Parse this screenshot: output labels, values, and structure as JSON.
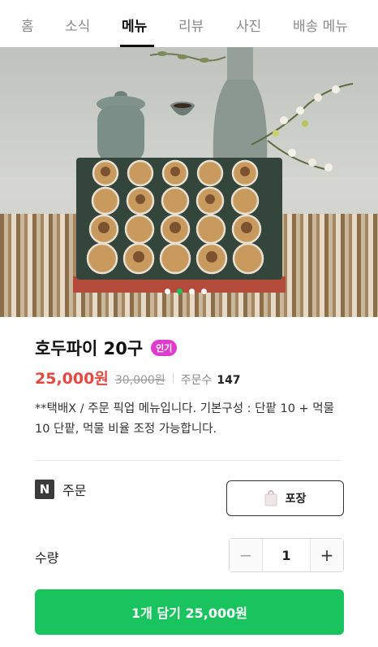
{
  "tabs": [
    {
      "label": "홈"
    },
    {
      "label": "소식"
    },
    {
      "label": "메뉴"
    },
    {
      "label": "리뷰"
    },
    {
      "label": "사진"
    },
    {
      "label": "배송 메뉴"
    }
  ],
  "active_tab": "메뉴",
  "carousel": {
    "total": 4,
    "active_index": 1
  },
  "product": {
    "title": "호두파이 20구",
    "badge": "인기",
    "price": "25,000원",
    "old_price": "30,000원",
    "orders_label": "주문수",
    "orders_count": "147",
    "description": "**택배X / 주문 픽업 메뉴입니다. 기본구성 : 단팥 10 + 먹물 10 단팥, 먹물 비율 조정 가능합니다."
  },
  "order": {
    "icon_letter": "N",
    "label": "주문",
    "pack_label": "포장"
  },
  "quantity": {
    "label": "수량",
    "minus": "−",
    "value": "1",
    "plus": "+"
  },
  "cart_button": {
    "label": "1개 담기 25,000원"
  },
  "colors": {
    "accent_green": "#19c35d",
    "price_red": "#e5483c",
    "badge_pink": "#e03bcf"
  }
}
